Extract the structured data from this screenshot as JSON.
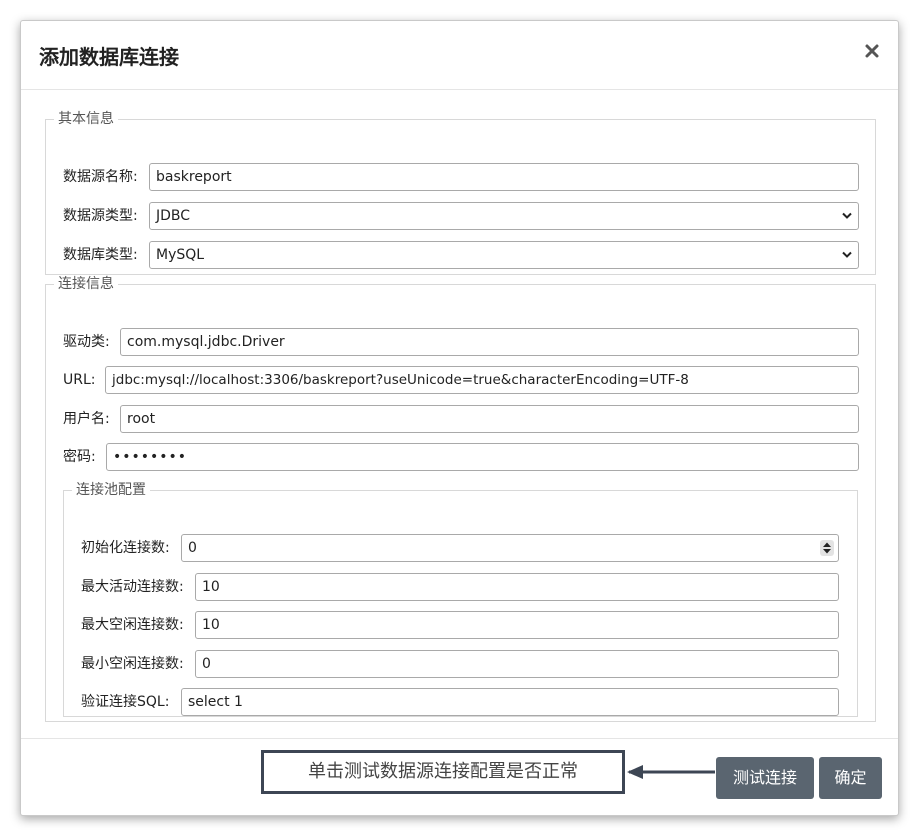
{
  "dialog": {
    "title": "添加数据库连接",
    "close_icon": "close-icon"
  },
  "basic_info": {
    "legend": "其本信息",
    "datasource_name": {
      "label": "数据源名称:",
      "value": "baskreport"
    },
    "datasource_type": {
      "label": "数据源类型:",
      "value": "JDBC"
    },
    "database_type": {
      "label": "数据库类型:",
      "value": "MySQL"
    }
  },
  "connection_info": {
    "legend": "连接信息",
    "driver": {
      "label": "驱动类:",
      "value": "com.mysql.jdbc.Driver"
    },
    "url": {
      "label": "URL:",
      "value": "jdbc:mysql://localhost:3306/baskreport?useUnicode=true&characterEncoding=UTF-8"
    },
    "username": {
      "label": "用户名:",
      "value": "root"
    },
    "password": {
      "label": "密码:",
      "value": "••••••••"
    }
  },
  "pool_config": {
    "legend": "连接池配置",
    "initial_connections": {
      "label": "初始化连接数:",
      "value": "0"
    },
    "max_active": {
      "label": "最大活动连接数:",
      "value": "10"
    },
    "max_idle": {
      "label": "最大空闲连接数:",
      "value": "10"
    },
    "min_idle": {
      "label": "最小空闲连接数:",
      "value": "0"
    },
    "validation_sql": {
      "label": "验证连接SQL:",
      "value": "select 1"
    }
  },
  "footer": {
    "callout_text": "单击测试数据源连接配置是否正常",
    "test_button": "测试连接",
    "confirm_button": "确定"
  },
  "colors": {
    "button_bg": "#5a6570",
    "callout_border": "#3d4654"
  }
}
